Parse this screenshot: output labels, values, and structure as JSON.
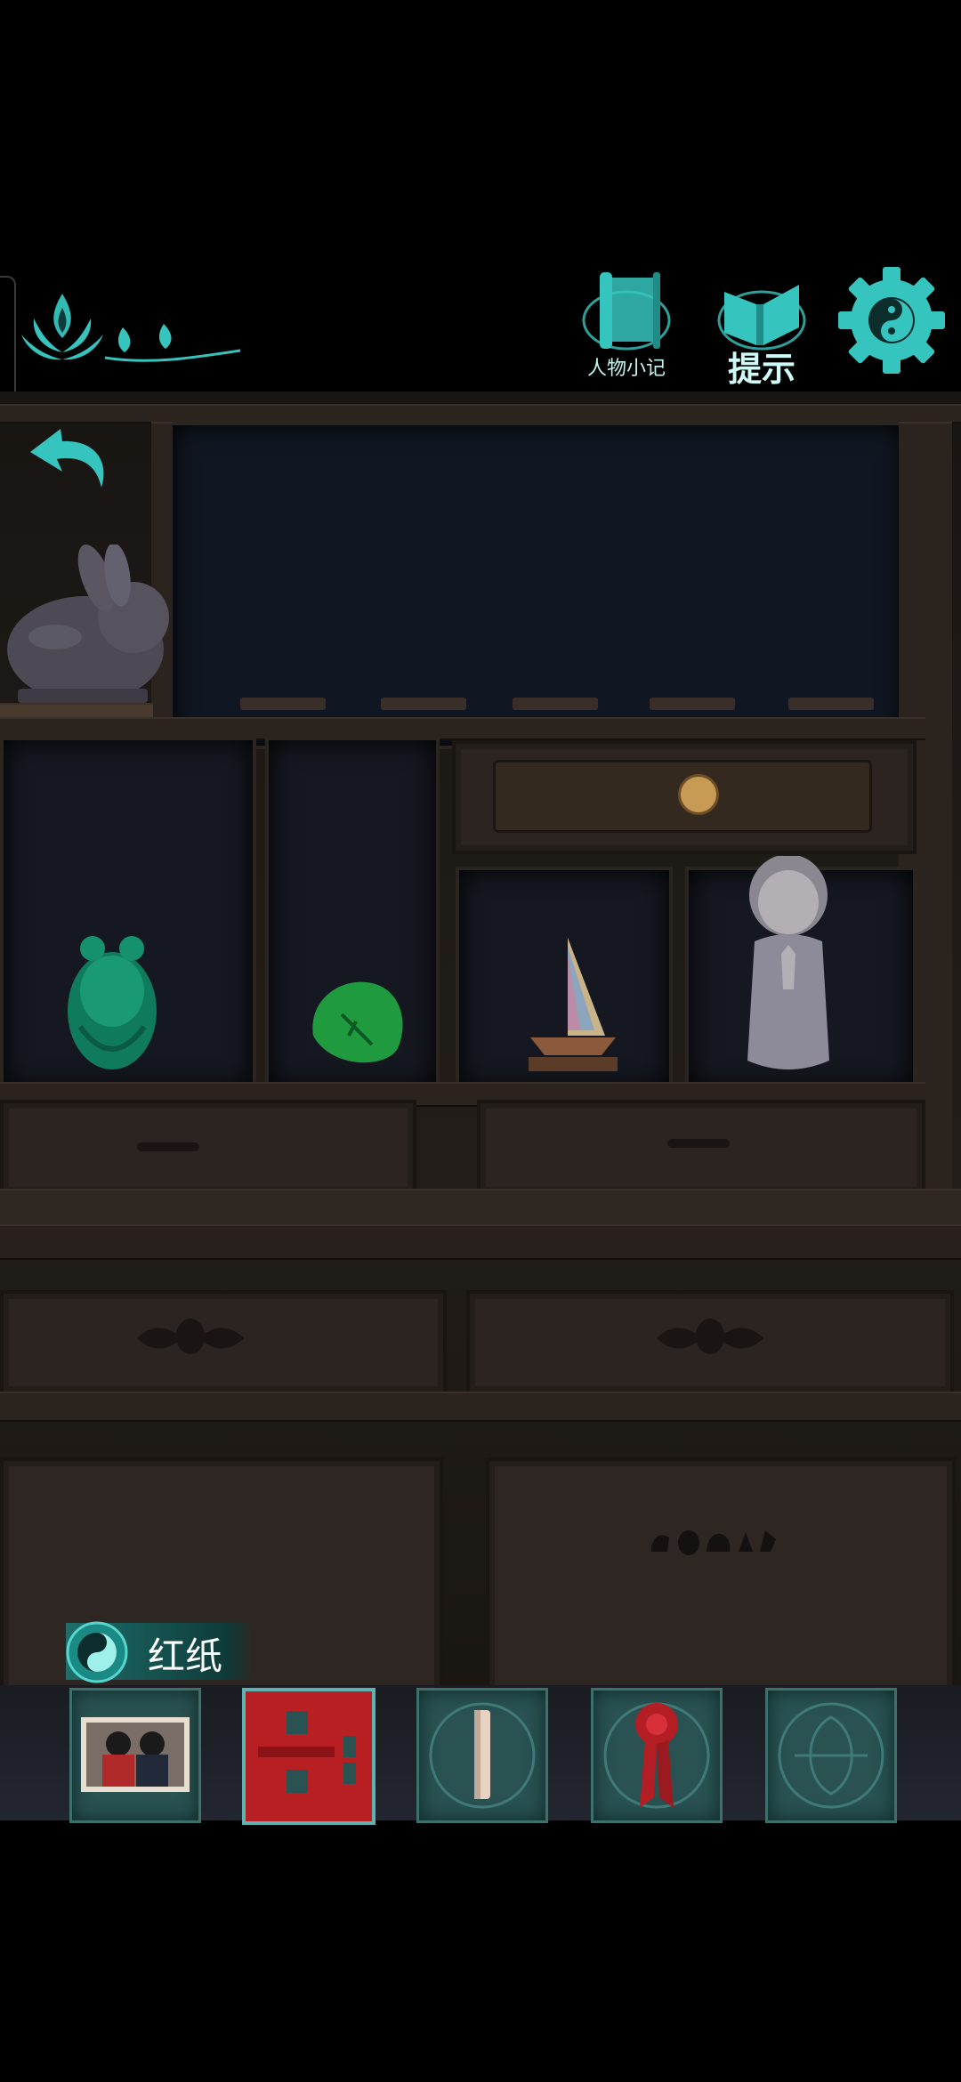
{
  "hud": {
    "character_notes_label": "人物小记",
    "hint_label": "提示",
    "settings_icon": "yin-yang-gear-icon",
    "lotus_icon": "lotus-flame-icon",
    "back_icon": "back-arrow-icon"
  },
  "scene": {
    "items": [
      "rabbit-figurine",
      "jade-frog",
      "green-stone",
      "sailboat-model",
      "praying-child-figurine"
    ],
    "door_symbols": "象"
  },
  "inventory": {
    "selected_label": "红纸",
    "slots": [
      {
        "name": "photo-card",
        "selected": false
      },
      {
        "name": "red-paper",
        "selected": true
      },
      {
        "name": "chalk-stick",
        "selected": false
      },
      {
        "name": "red-ribbon-flower",
        "selected": false
      },
      {
        "name": "empty-slot",
        "selected": false
      }
    ]
  },
  "colors": {
    "accent": "#36c4be",
    "red_paper": "#a51c1e",
    "slot_bg": "#2a5253"
  }
}
